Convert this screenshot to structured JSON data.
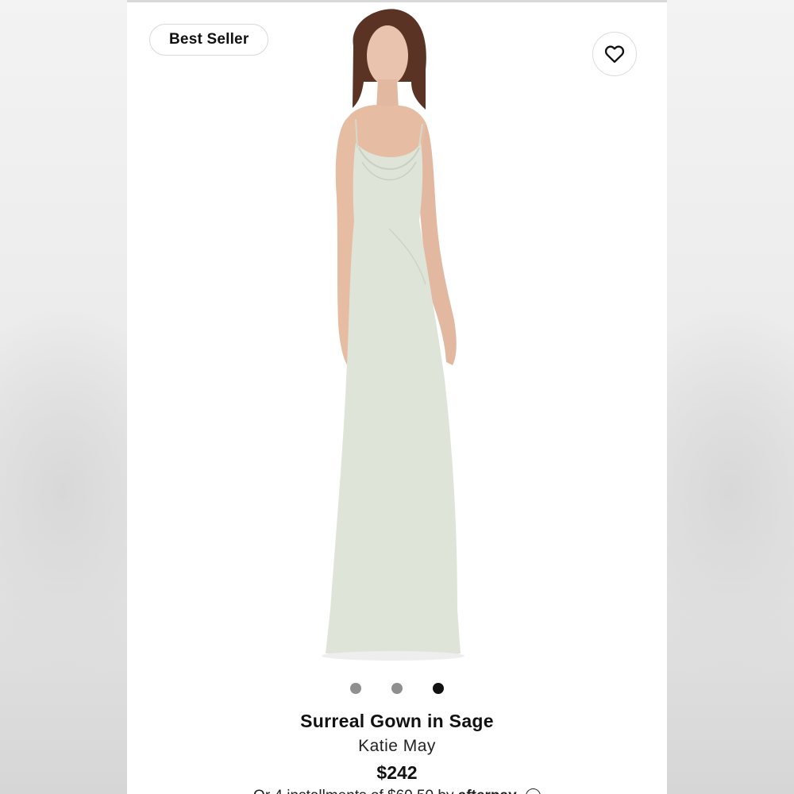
{
  "badge": {
    "label": "Best Seller"
  },
  "favorite": {
    "icon": "heart-icon"
  },
  "product": {
    "title": "Surreal Gown in Sage",
    "brand": "Katie May",
    "price": "$242",
    "installments": {
      "text": "Or 4 installments of $60.50 by",
      "provider": "afterpay",
      "icon": "info-icon"
    },
    "dress_color": "#dfe4d8"
  },
  "carousel": {
    "total": 3,
    "active_index": 2,
    "active_color": "#111111",
    "inactive_color": "#8f8f8f"
  }
}
